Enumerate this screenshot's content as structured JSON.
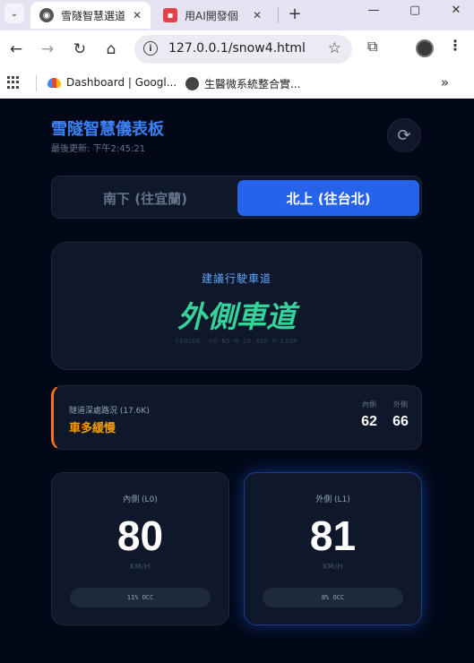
{
  "browser": {
    "tabs": [
      {
        "title": "雪隧智慧選道",
        "active": true
      },
      {
        "title": "用AI開發個",
        "active": false
      }
    ],
    "url": "127.0.0.1/snow4.html",
    "bookmarks": [
      {
        "label": "Dashboard | Googl...",
        "icon": "cloud-icon"
      },
      {
        "label": "生醫微系統整合實...",
        "icon": "globe-icon"
      }
    ],
    "more_bookmarks": "»"
  },
  "app": {
    "title": "雪隧智慧儀表板",
    "last_updated": "最後更新: 下午2:45:21"
  },
  "direction": {
    "south": "南下 (往宜蘭)",
    "north": "北上 (往台北)",
    "selected": "north"
  },
  "recommendation": {
    "label": "建議行駛車道",
    "lane": "外側車道",
    "sensor": "SENSOR: VD-N5-N-28.428-M-LOOP"
  },
  "traffic": {
    "section": "隧道深處路況 (17.6K)",
    "status": "車多緩慢",
    "inner_label": "內側",
    "inner_value": "62",
    "outer_label": "外側",
    "outer_value": "66"
  },
  "lanes": [
    {
      "name": "內側 (L0)",
      "speed": "80",
      "unit": "KM/H",
      "occupancy": "11% OCC",
      "highlighted": false
    },
    {
      "name": "外側 (L1)",
      "speed": "81",
      "unit": "KM/H",
      "occupancy": "8% OCC",
      "highlighted": true
    }
  ],
  "colors": {
    "accent": "#2563eb",
    "title": "#3b82f6",
    "recommend": "#34d399",
    "warning": "#f59e0b",
    "alert_bar": "#f97316"
  }
}
